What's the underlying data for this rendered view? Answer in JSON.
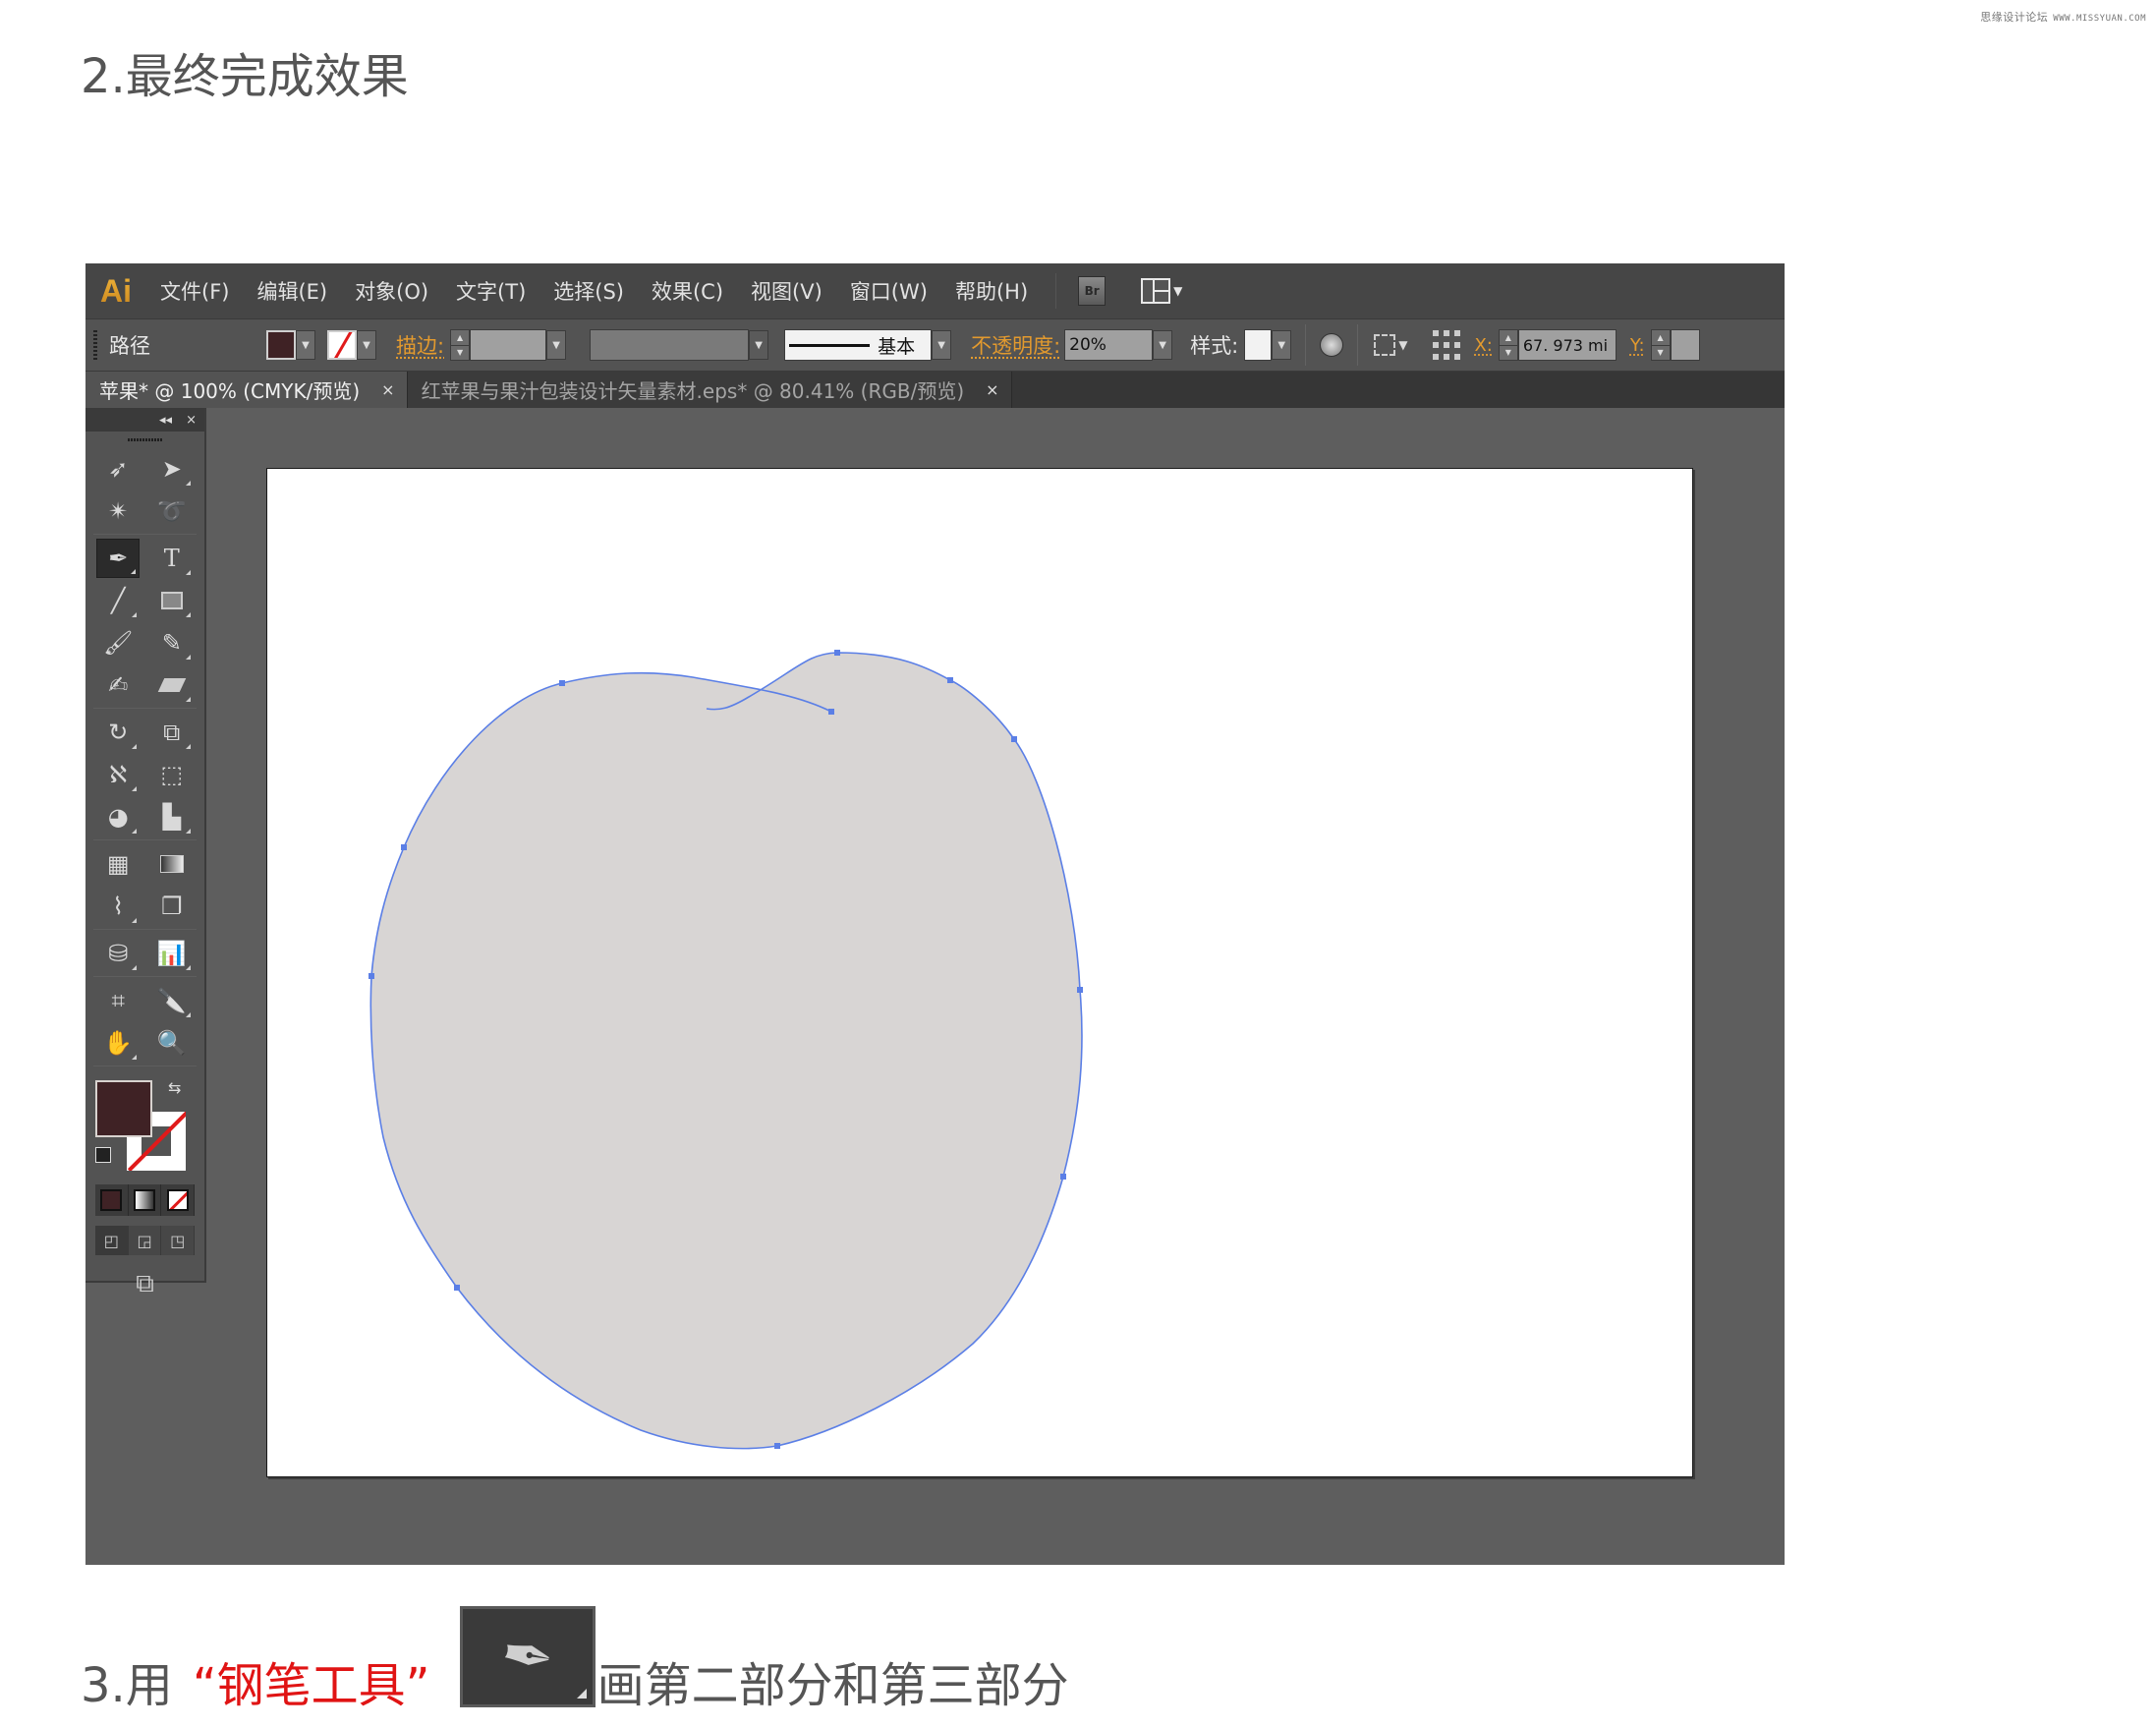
{
  "watermark": {
    "site_name": "思缘设计论坛",
    "url": "WWW.MISSYUAN.COM"
  },
  "heading": "2.最终完成效果",
  "app": {
    "logo": "Ai",
    "menu": [
      "文件(F)",
      "编辑(E)",
      "对象(O)",
      "文字(T)",
      "选择(S)",
      "效果(C)",
      "视图(V)",
      "窗口(W)",
      "帮助(H)"
    ],
    "bridge_label": "Br",
    "control_bar": {
      "object_type": "路径",
      "fill_color": "#3f2225",
      "stroke_label": "描边:",
      "stroke_profile": "基本",
      "opacity_label": "不透明度:",
      "opacity_value": "20%",
      "style_label": "样式:",
      "x_label": "X:",
      "x_value": "67. 973 mi",
      "y_label": "Y:"
    },
    "tabs": [
      {
        "label": "苹果* @ 100% (CMYK/预览)",
        "active": true,
        "close": "×"
      },
      {
        "label": "红苹果与果汁包装设计矢量素材.eps* @ 80.41% (RGB/预览)",
        "active": false,
        "close": "×"
      }
    ],
    "tools_panel": {
      "collapse": "◂◂",
      "close": "×",
      "rows": [
        [
          "selection-tool",
          "direct-selection-tool"
        ],
        [
          "magic-wand-tool",
          "lasso-tool"
        ],
        [
          "pen-tool",
          "type-tool"
        ],
        [
          "line-segment-tool",
          "rectangle-tool"
        ],
        [
          "paintbrush-tool",
          "pencil-tool"
        ],
        [
          "blob-brush-tool",
          "eraser-tool"
        ],
        [
          "rotate-tool",
          "scale-tool"
        ],
        [
          "warp-tool",
          "free-transform-tool"
        ],
        [
          "shape-builder-tool",
          "perspective-grid-tool"
        ],
        [
          "mesh-tool",
          "gradient-tool"
        ],
        [
          "eyedropper-tool",
          "blend-tool"
        ],
        [
          "symbol-sprayer-tool",
          "column-graph-tool"
        ],
        [
          "artboard-tool",
          "slice-tool"
        ],
        [
          "hand-tool",
          "zoom-tool"
        ]
      ],
      "selected_tool": "pen-tool"
    },
    "shape": {
      "fill": "#d8d5d4",
      "stroke": "#5b7fe6"
    }
  },
  "step3": {
    "prefix": "3.用",
    "tool_name": "“钢笔工具”",
    "suffix": "画第二部分和第三部分",
    "accent_color": "#e01414"
  }
}
